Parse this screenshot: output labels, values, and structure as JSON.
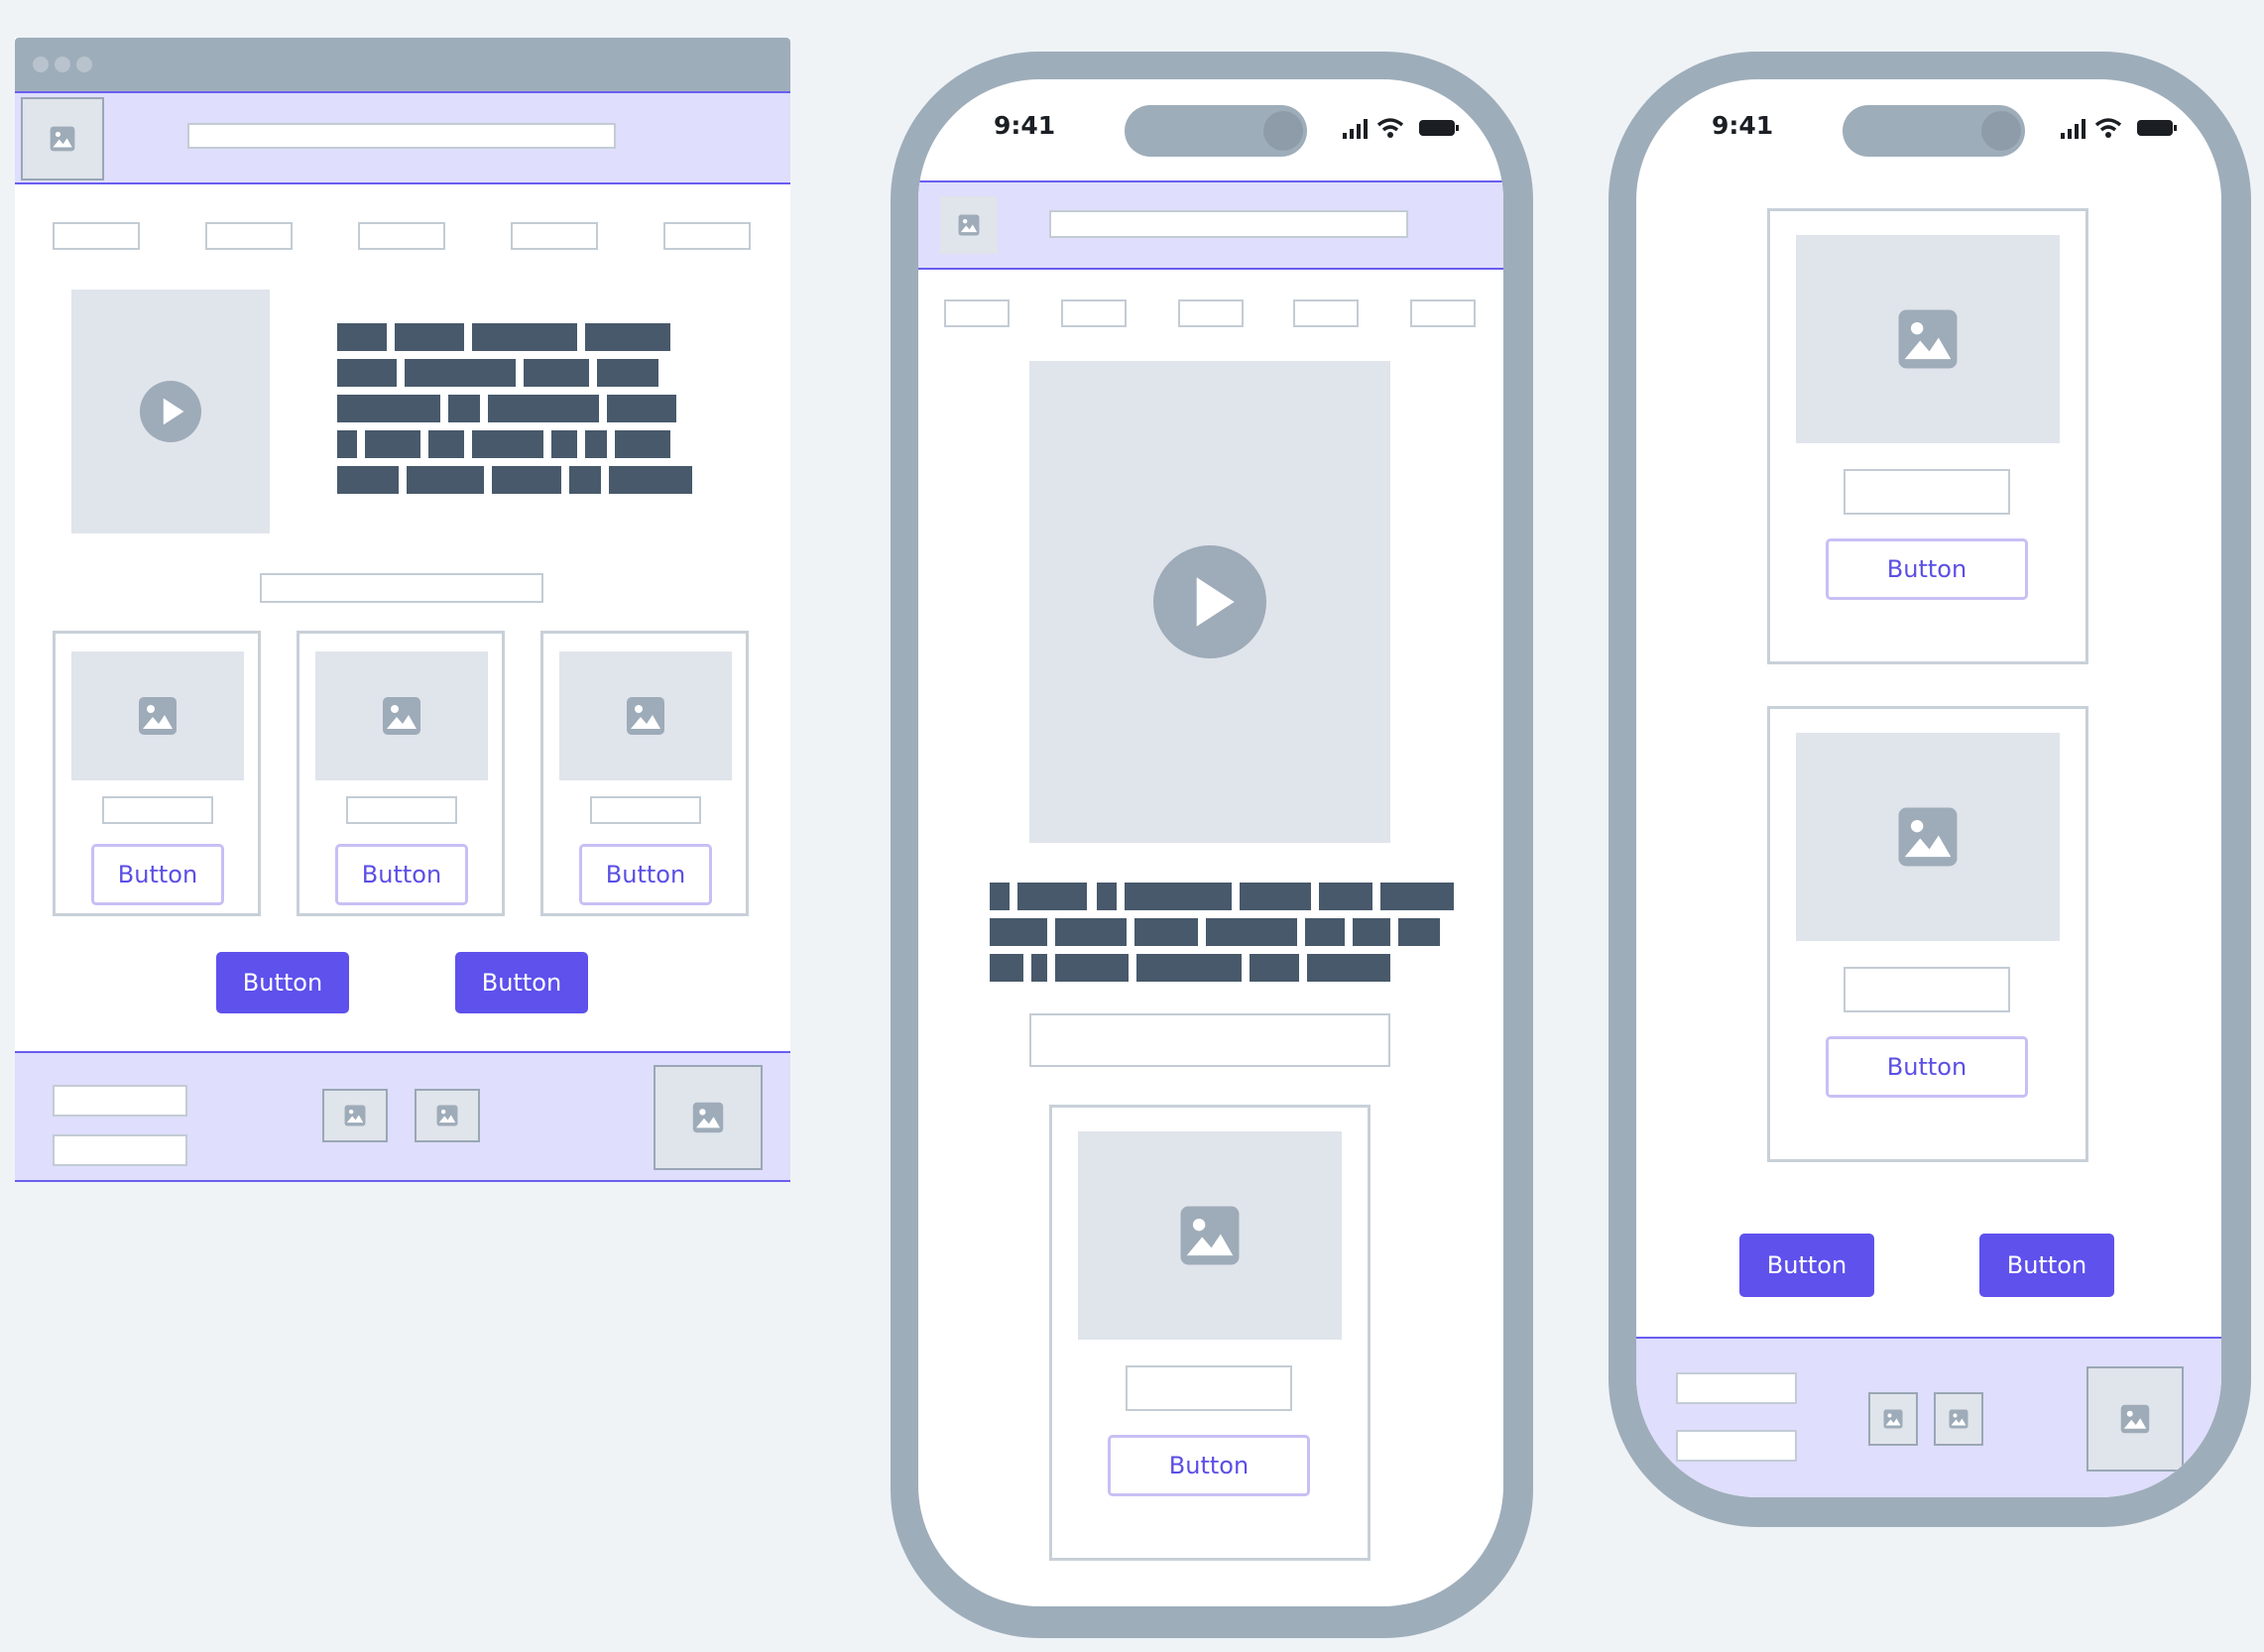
{
  "desktop": {
    "buttons": {
      "card_button": "Button",
      "primary_button": "Button",
      "secondary_button": "Button"
    }
  },
  "phone1": {
    "status": {
      "time": "9:41"
    },
    "card_button": "Button"
  },
  "phone2": {
    "status": {
      "time": "9:41"
    },
    "card_button": "Button",
    "primary_button": "Button",
    "secondary_button": "Button"
  },
  "colors": {
    "accent": "#5e51ec",
    "band": "#dfdefc",
    "frame": "#9eadba",
    "text_block": "#48596b"
  }
}
